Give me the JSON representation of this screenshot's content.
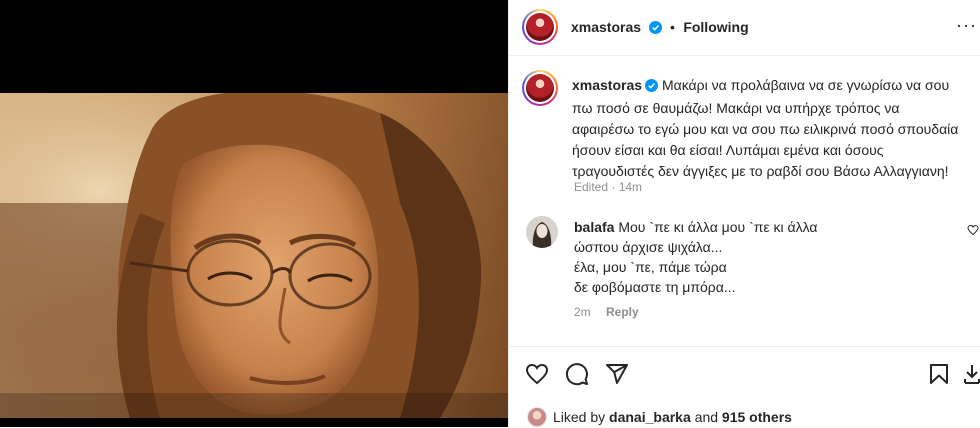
{
  "post": {
    "author": "xmastoras",
    "follow_status": "Following",
    "dot": "•",
    "more": "···"
  },
  "caption": {
    "username": "xmastoras",
    "text": "Μακάρι να προλάβαινα να σε γνωρίσω να σου πω ποσό σε θαυμάζω! Μακάρι να υπήρχε τρόπος να αφαιρέσω το εγώ μου και να σου πω ειλικρινά ποσό σπουδαία ήσουν είσαι και θα είσαι! Λυπάμαι εμένα και όσους τραγουδιστές δεν άγγιξες με το ραβδί σου Βάσω Αλλαγγιανη!",
    "edited": "Edited",
    "time": "14m"
  },
  "comment": {
    "username": "balafa",
    "lines": [
      "Μου `πε κι άλλα μου `πε κι άλλα",
      "ώσπου άρχισε ψιχάλα...",
      "έλα, μου `πε, πάμε τώρα",
      "δε φοβόμαστε τη μπόρα..."
    ],
    "time": "2m",
    "reply": "Reply"
  },
  "likes": {
    "prefix": "Liked by",
    "user": "danai_barka",
    "middle": "and",
    "others": "915 others"
  },
  "icons": {
    "verified": "verified-badge-icon",
    "like": "heart-icon",
    "comment": "comment-icon",
    "share": "paper-plane-icon",
    "save": "bookmark-icon",
    "download": "download-icon"
  },
  "colors": {
    "verified": "#0095f6",
    "text": "#262626",
    "secondary": "#8e8e8e",
    "media_bg": "#000000"
  }
}
